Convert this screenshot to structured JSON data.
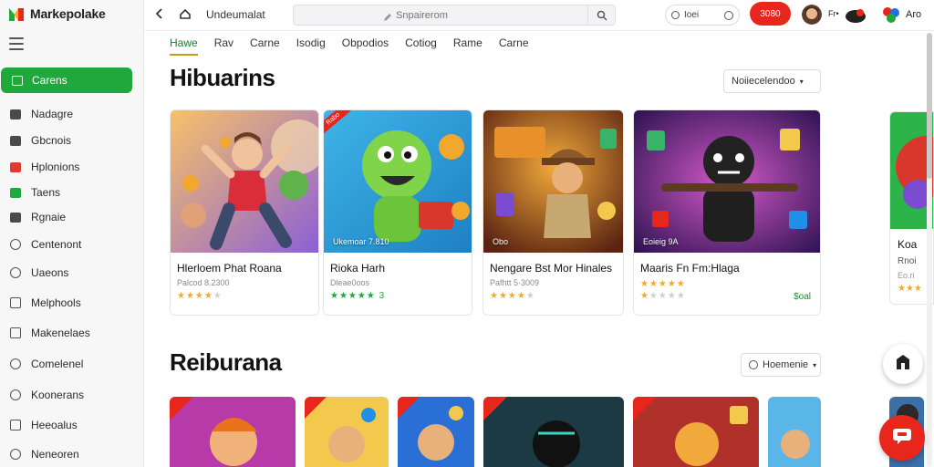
{
  "app": {
    "name": "Markepolake"
  },
  "topbar": {
    "title": "Undeumalat",
    "search_placeholder": "Snpairerom",
    "mini_field_label": "Ioei",
    "red_pill_label": "3080",
    "user_label_1": "Fr•",
    "user_label_2": "Aro"
  },
  "sidebar": {
    "active": {
      "label": "Carens",
      "icon": "grid-icon"
    },
    "items": [
      {
        "label": "Nadagre",
        "icon": "box-icon"
      },
      {
        "label": "Gbcnois",
        "icon": "bag-icon"
      },
      {
        "label": "Hplonions",
        "icon": "gift-icon"
      },
      {
        "label": "Taens",
        "icon": "tag-icon"
      },
      {
        "label": "Rgnaie",
        "icon": "folder-icon"
      },
      {
        "label": "Centenont",
        "icon": "clock-icon"
      },
      {
        "label": "Uaeons",
        "icon": "gamepad-icon"
      },
      {
        "label": "Melphools",
        "icon": "book-icon"
      },
      {
        "label": "Makenelaes",
        "icon": "list-icon"
      },
      {
        "label": "Comelenel",
        "icon": "link-icon"
      },
      {
        "label": "Koonerans",
        "icon": "compass-icon"
      },
      {
        "label": "Heeoalus",
        "icon": "grid-icon"
      },
      {
        "label": "Neneoren",
        "icon": "user-icon"
      }
    ]
  },
  "tabs": [
    "Hawe",
    "Rav",
    "Carne",
    "Isodig",
    "Obpodios",
    "Cotiog",
    "Rame",
    "Carne"
  ],
  "section1": {
    "title": "Hibuarins",
    "sort_label": "Noiiecelendoo",
    "cards": [
      {
        "title": "Hlerloem Phat Roana",
        "sub": "Palcod 8.2300",
        "overlay": "",
        "ribbon": "",
        "rating": 4,
        "price": ""
      },
      {
        "title": "Rioka Harh",
        "sub": "Dleae0oos",
        "overlay": "Ukemoar 7.810",
        "ribbon": "Rabo",
        "rating": 5,
        "rating_note": "3",
        "price": ""
      },
      {
        "title": "Nengare Bst Mor Hinales",
        "sub": "Pafhtt 5·3009",
        "overlay": "Obo",
        "ribbon": "",
        "rating": 4,
        "price": ""
      },
      {
        "title": "Maaris Fn Fm:Hlaga",
        "sub": "",
        "overlay": "Eoieig 9A",
        "ribbon": "",
        "rating": 1,
        "price": "$oal"
      }
    ],
    "peek": {
      "title": "Koa",
      "sub": "Rnoi",
      "sub2": "Eo.ri"
    }
  },
  "section2": {
    "title": "Reiburana",
    "sort_label": "Hoemenie"
  },
  "colors": {
    "accent": "#1fa83c",
    "brand_red": "#e8271c",
    "star": "#f0a92b"
  }
}
